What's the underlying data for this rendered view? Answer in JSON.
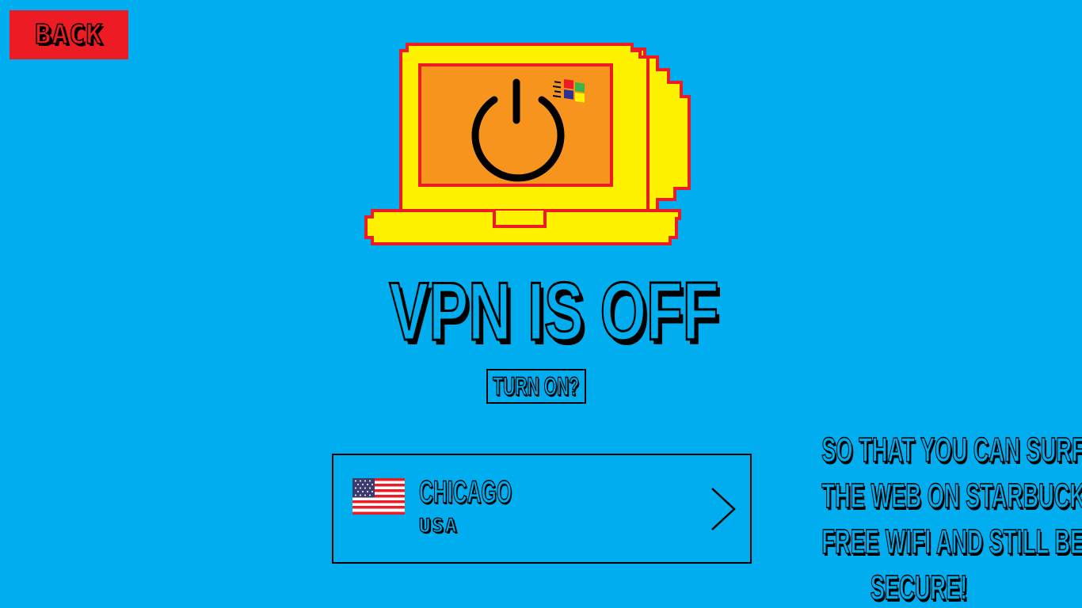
{
  "header": {
    "back_label": "BACK"
  },
  "status": {
    "title": "VPN IS OFF",
    "action_label": "TURN ON?"
  },
  "location": {
    "city": "CHICAGO",
    "country": "USA",
    "flag_icon": "us-flag-icon"
  },
  "tagline": {
    "lines": [
      "SO THAT YOU CAN SURF",
      "THE WEB ON STARBUCKS'",
      "FREE WIFI AND STILL BE",
      "SECURE!"
    ]
  },
  "colors": {
    "background": "#00aeef",
    "accent_red": "#ed1c24",
    "laptop_yellow": "#fff200",
    "screen_orange": "#f7941d"
  },
  "icons": {
    "laptop": "laptop-icon",
    "power": "power-icon",
    "windows_logo": "windows-logo-icon",
    "chevron": "chevron-right-icon"
  }
}
